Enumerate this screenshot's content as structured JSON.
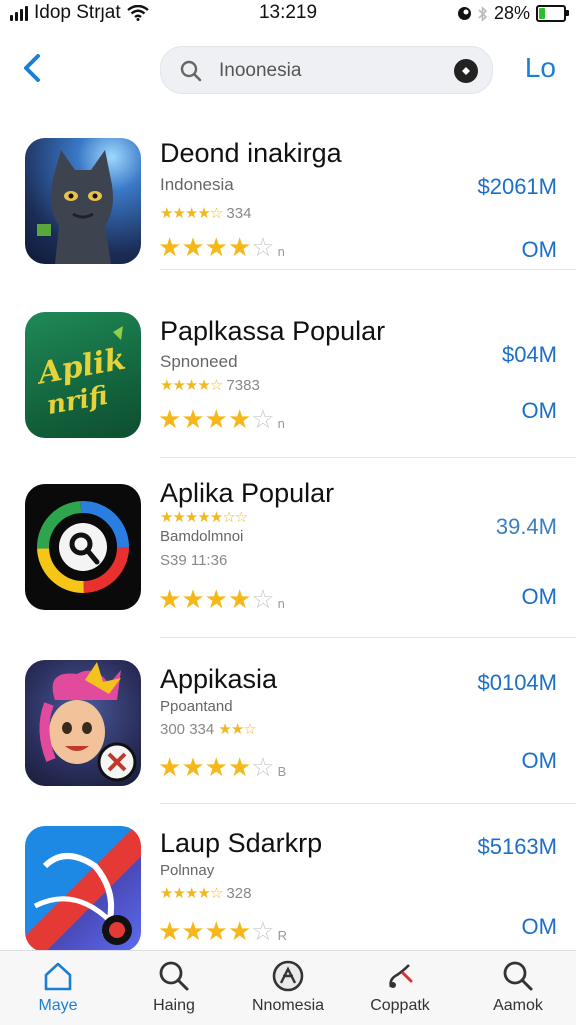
{
  "status_bar": {
    "carrier": "Idop Strȷat",
    "time": "13:219",
    "battery": "28%",
    "battery_level": 0.28
  },
  "nav": {
    "back_icon": "chevron-left-icon",
    "search_value": "Inoonesia",
    "search_icon": "search-icon",
    "action_label": "Lo"
  },
  "accent": "#1b7fd6",
  "apps": [
    {
      "name": "Deond inakirga",
      "subtitle": "Indonesia",
      "rating_line": "334",
      "stars": 4,
      "stars_suffix": "n",
      "price": "$2061M",
      "size": "OM"
    },
    {
      "name": "Paplkassa Popular",
      "subtitle": "Spnoneed",
      "rating_line": "7383",
      "stars": 3.5,
      "stars_suffix": "n",
      "price": "$04M",
      "size": "OM"
    },
    {
      "name": "Aplika Popular",
      "subtitle": "Bamdolmnoi",
      "rating_line": "S39 11:36",
      "stars": 4,
      "stars_suffix": "n",
      "price": "39.4M",
      "size": "OM"
    },
    {
      "name": "Appikasia",
      "subtitle": "Ppoantand",
      "rating_line": "300 334",
      "stars": 4,
      "stars_suffix": "B",
      "price": "$0104M",
      "size": "OM"
    },
    {
      "name": "Laup Sdarkrp",
      "subtitle": "Polnnay",
      "rating_line": "328",
      "stars": 4,
      "stars_suffix": "R",
      "price": "$5163M",
      "size": "OM"
    }
  ],
  "tabs": [
    {
      "label": "Maye",
      "icon": "home-icon"
    },
    {
      "label": "Haing",
      "icon": "search-icon"
    },
    {
      "label": "Nnomesia",
      "icon": "compass-icon"
    },
    {
      "label": "Coppatk",
      "icon": "pen-icon"
    },
    {
      "label": "Aamok",
      "icon": "search-icon"
    }
  ]
}
